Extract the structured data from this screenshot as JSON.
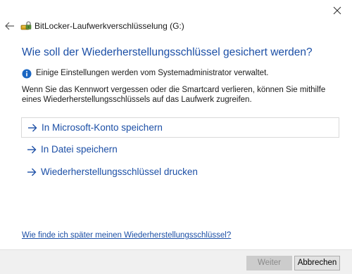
{
  "window": {
    "title": "BitLocker-Laufwerkverschlüsselung (G:)",
    "close_icon": "close-icon",
    "back_icon": "back-arrow-icon",
    "app_icon": "bitlocker-drive-icon"
  },
  "main": {
    "heading": "Wie soll der Wiederherstellungsschlüssel gesichert werden?",
    "info": {
      "icon": "info-icon",
      "text": "Einige Einstellungen werden vom Systemadministrator verwaltet."
    },
    "description": "Wenn Sie das Kennwort vergessen oder die Smartcard verlieren, können Sie mithilfe eines Wiederherstellungsschlüssels auf das Laufwerk zugreifen.",
    "options": [
      {
        "label": "In Microsoft-Konto speichern",
        "icon": "arrow-right-icon"
      },
      {
        "label": "In Datei speichern",
        "icon": "arrow-right-icon"
      },
      {
        "label": "Wiederherstellungsschlüssel drucken",
        "icon": "arrow-right-icon"
      }
    ],
    "help_link": "Wie finde ich später meinen Wiederherstellungsschlüssel?"
  },
  "footer": {
    "next_label": "Weiter",
    "next_enabled": false,
    "cancel_label": "Abbrechen"
  },
  "colors": {
    "accent": "#1c4fa6",
    "info_icon": "#1a66c2",
    "footer_bg": "#f0f0f0"
  }
}
